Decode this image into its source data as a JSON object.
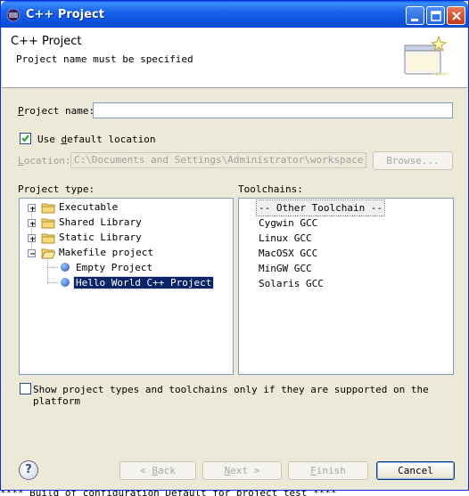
{
  "window": {
    "title": "C++ Project",
    "controls": {
      "minimize": "minimize",
      "maximize": "maximize",
      "close": "close"
    }
  },
  "header": {
    "title": "C++ Project",
    "message": "Project name must be specified"
  },
  "project_name": {
    "label_u": "P",
    "label_rest": "roject name:",
    "value": ""
  },
  "default_location": {
    "checked": true,
    "label_pre": "Use ",
    "label_u": "d",
    "label_rest": "efault location"
  },
  "location": {
    "label_u": "L",
    "label_rest": "ocation:",
    "value": "C:\\Documents and Settings\\Administrator\\workspace",
    "browse_label": "Browse..."
  },
  "project_type": {
    "label": "Project type:",
    "items": [
      {
        "label": "Executable",
        "expander": "+"
      },
      {
        "label": "Shared Library",
        "expander": "+"
      },
      {
        "label": "Static Library",
        "expander": "+"
      },
      {
        "label": "Makefile project",
        "expander": "-"
      },
      {
        "label": "Empty Project"
      },
      {
        "label": "Hello World C++ Project"
      }
    ]
  },
  "toolchains": {
    "label": "Toolchains:",
    "items": [
      "-- Other Toolchain --",
      "Cygwin GCC",
      "Linux GCC",
      "MacOSX GCC",
      "MinGW GCC",
      "Solaris GCC"
    ]
  },
  "filter_checkbox": {
    "checked": false,
    "label": "Show project types and toolchains only if they are supported on the platform"
  },
  "buttons": {
    "help": "?",
    "back_pre": "< ",
    "back_u": "B",
    "back_rest": "ack",
    "next_u": "N",
    "next_rest": "ext >",
    "finish_u": "F",
    "finish_rest": "inish",
    "cancel": "Cancel"
  },
  "status_text": "**** Build of configuration Default for project test ****"
}
